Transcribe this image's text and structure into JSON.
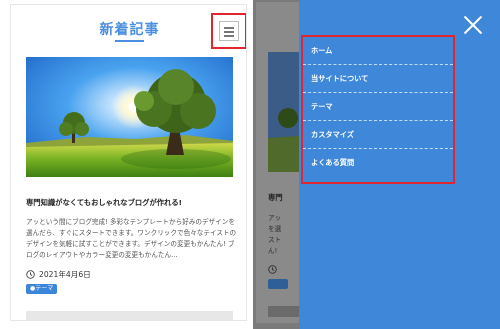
{
  "left": {
    "header_title": "新着記事",
    "article_title": "専門知識がなくてもおしゃれなブログが作れる!",
    "excerpt": "アッという間にブログ完成! 多彩なテンプレートから好みのデザインを選んだら、すぐにスタートできます。ワンクリックで色々なテイストのデザインを気軽に試すことができます。デザインの変更もかんたん! ブログのレイアウトやカラー変更の変更もかんたん…",
    "date": "2021年4月6日",
    "tag": "●テーマ"
  },
  "right": {
    "menu": {
      "items": [
        {
          "label": "ホーム"
        },
        {
          "label": "当サイトについて"
        },
        {
          "label": "テーマ"
        },
        {
          "label": "カスタマイズ"
        },
        {
          "label": "よくある質問"
        }
      ]
    }
  },
  "colors": {
    "accent": "#4a8fe0",
    "drawer": "#3e87d9",
    "highlight": "#e0262f"
  },
  "icons": [
    "hamburger-icon",
    "close-icon",
    "clock-icon"
  ]
}
